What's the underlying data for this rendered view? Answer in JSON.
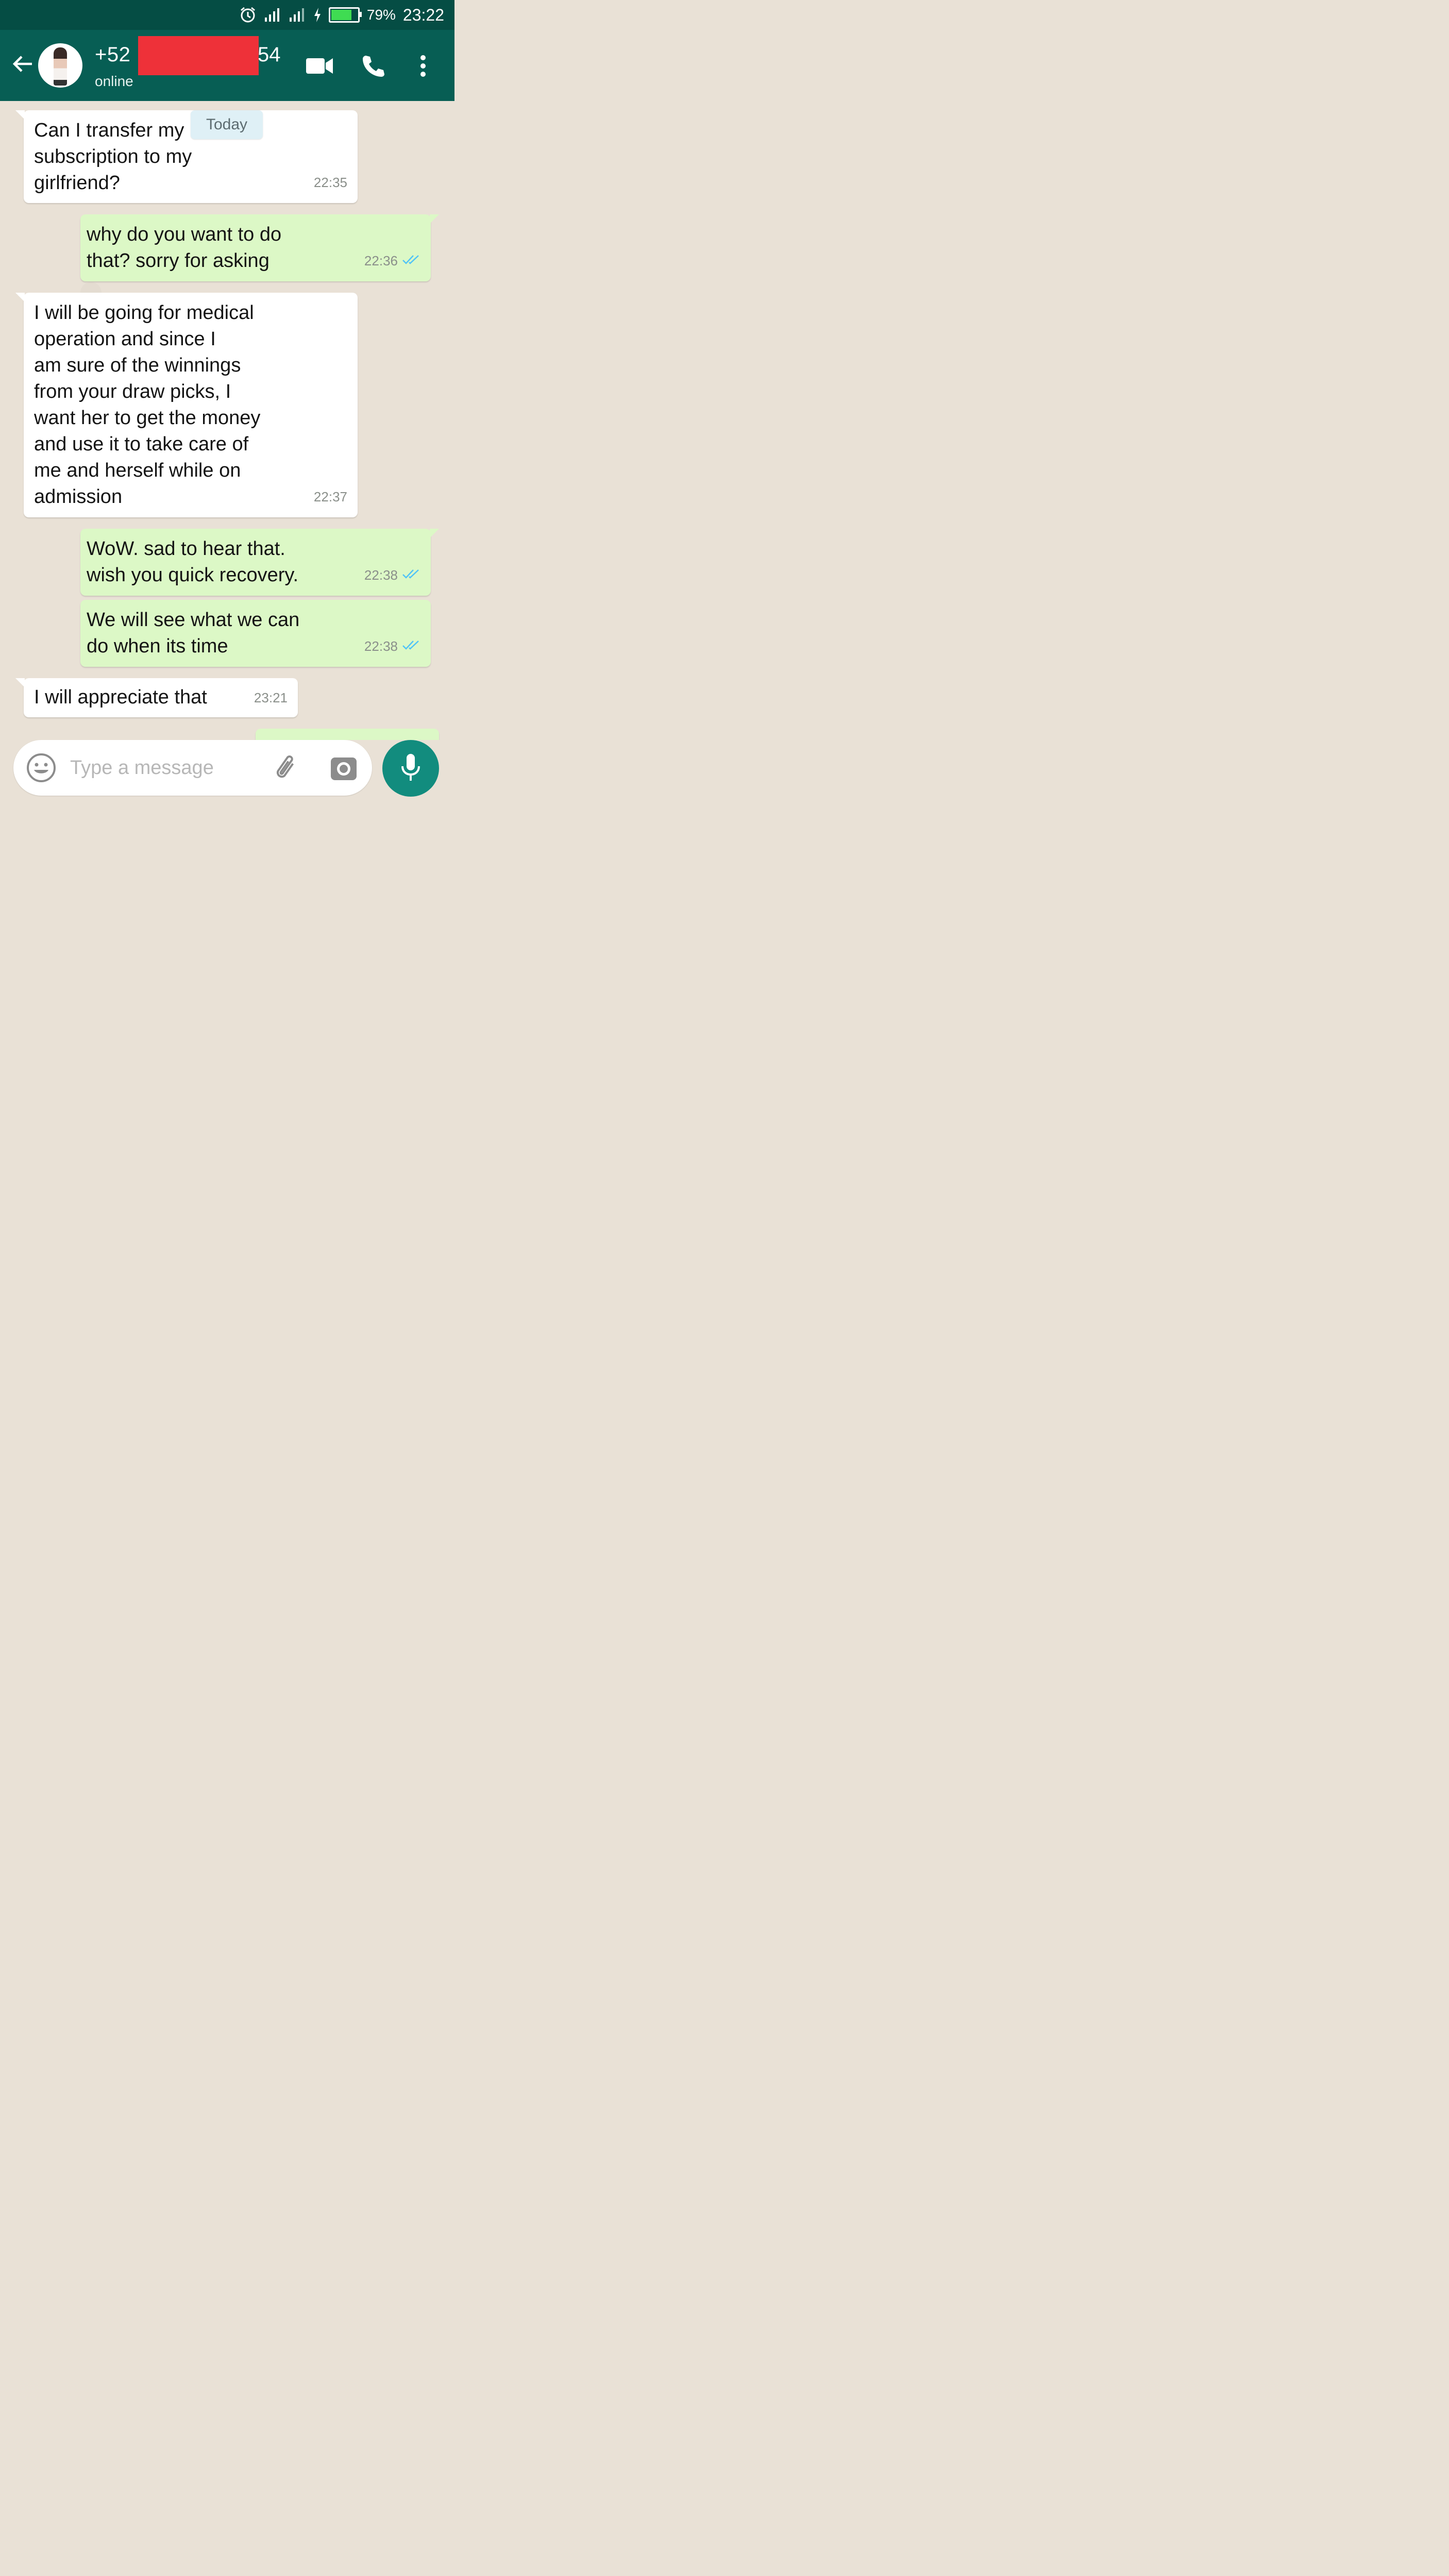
{
  "status_bar": {
    "battery_percent": "79%",
    "time": "23:22",
    "battery_level": 0.79
  },
  "header": {
    "contact_prefix": "+52",
    "contact_suffix": "54",
    "status": "online"
  },
  "chat": {
    "date_chip": "Today",
    "messages": [
      {
        "direction": "in",
        "text": "Can I transfer my\nsubscription to my\ngirlfriend?",
        "time": "22:35"
      },
      {
        "direction": "out",
        "text": "why do you want to do\nthat? sorry for asking",
        "time": "22:36",
        "read": true
      },
      {
        "direction": "in",
        "text": "I will be going for medical\noperation and since I\nam sure of the winnings\nfrom your draw picks, I\nwant her to get the money\nand use it to take care of\nme and herself while on\nadmission",
        "time": "22:37"
      },
      {
        "direction": "out",
        "text": "WoW. sad to hear that.\nwish you quick recovery.",
        "time": "22:38",
        "read": true
      },
      {
        "direction": "out",
        "text": "We will see what we can\ndo when its time",
        "time": "22:38",
        "read": true
      },
      {
        "direction": "in",
        "text": "I will appreciate that",
        "time": "23:21"
      }
    ]
  },
  "input": {
    "placeholder": "Type a message"
  },
  "colors": {
    "header": "#075e54",
    "status_bar": "#054d44",
    "outgoing_bubble": "#dcf8c6",
    "incoming_bubble": "#ffffff",
    "read_ticks": "#4fc3f7",
    "fab": "#128c7e",
    "redaction": "#ee3139"
  }
}
